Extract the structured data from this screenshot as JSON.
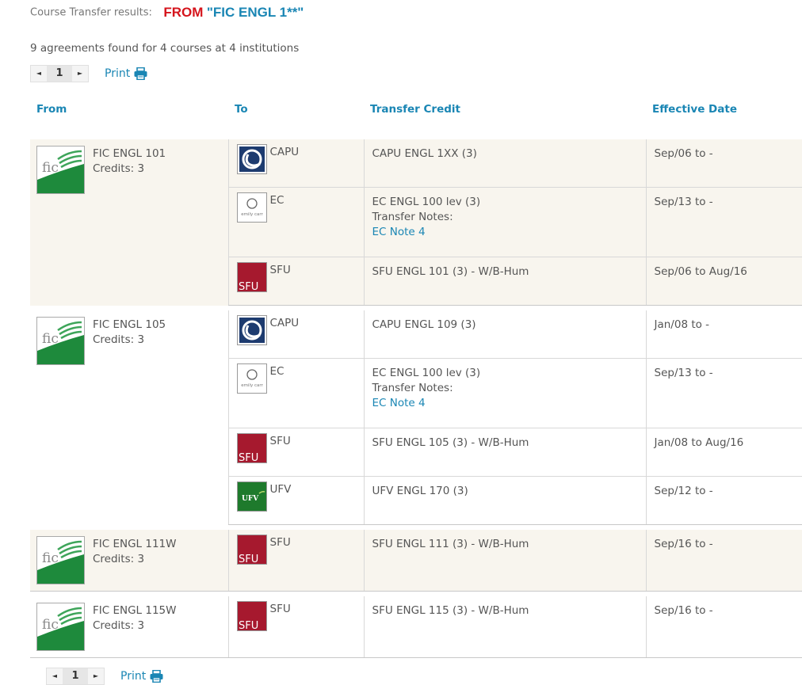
{
  "header": {
    "label": "Course Transfer results:",
    "from_label": "FROM",
    "query": "\"FIC ENGL 1**\""
  },
  "summary": "9 agreements found for 4 courses at 4 institutions",
  "pager": {
    "page": "1",
    "prev": "◄",
    "next": "►",
    "print_label": "Print"
  },
  "columns": [
    "From",
    "To",
    "Transfer Credit",
    "Effective Date"
  ],
  "logos": {
    "sfu_text": "SFU",
    "ufv_text": "UFV",
    "ec_text": "emily carr",
    "fic_text": "fic"
  },
  "colors": {
    "accent": "#1a86b4",
    "red": "#d5141c",
    "sfu_red": "#a6192e",
    "fic_green": "#1e8a3c",
    "ufv_green": "#1e7a2c",
    "capu_blue": "#1d3b6f",
    "row_shade": "#f8f5ee"
  },
  "groups": [
    {
      "course": "FIC ENGL 101",
      "credits": "Credits: 3",
      "rows": [
        {
          "inst": "CAPU",
          "logo": "capu",
          "credit": "CAPU ENGL 1XX (3)",
          "notes_label": "",
          "note": "",
          "date": "Sep/06 to -"
        },
        {
          "inst": "EC",
          "logo": "ec",
          "credit": "EC ENGL 100 lev (3)",
          "notes_label": "Transfer Notes:",
          "note": "EC Note 4",
          "date": "Sep/13 to -"
        },
        {
          "inst": "SFU",
          "logo": "sfu",
          "credit": "SFU ENGL 101 (3) - W/B-Hum",
          "notes_label": "",
          "note": "",
          "date": "Sep/06 to Aug/16"
        }
      ]
    },
    {
      "course": "FIC ENGL 105",
      "credits": "Credits: 3",
      "rows": [
        {
          "inst": "CAPU",
          "logo": "capu",
          "credit": "CAPU ENGL 109 (3)",
          "notes_label": "",
          "note": "",
          "date": "Jan/08 to -"
        },
        {
          "inst": "EC",
          "logo": "ec",
          "credit": "EC ENGL 100 lev (3)",
          "notes_label": "Transfer Notes:",
          "note": "EC Note 4",
          "date": "Sep/13 to -"
        },
        {
          "inst": "SFU",
          "logo": "sfu",
          "credit": "SFU ENGL 105 (3) - W/B-Hum",
          "notes_label": "",
          "note": "",
          "date": "Jan/08 to Aug/16"
        },
        {
          "inst": "UFV",
          "logo": "ufv",
          "credit": "UFV ENGL 170 (3)",
          "notes_label": "",
          "note": "",
          "date": "Sep/12 to -"
        }
      ]
    },
    {
      "course": "FIC ENGL 111W",
      "credits": "Credits: 3",
      "rows": [
        {
          "inst": "SFU",
          "logo": "sfu",
          "credit": "SFU ENGL 111 (3) - W/B-Hum",
          "notes_label": "",
          "note": "",
          "date": "Sep/16 to -"
        }
      ]
    },
    {
      "course": "FIC ENGL 115W",
      "credits": "Credits: 3",
      "rows": [
        {
          "inst": "SFU",
          "logo": "sfu",
          "credit": "SFU ENGL 115 (3) - W/B-Hum",
          "notes_label": "",
          "note": "",
          "date": "Sep/16 to -"
        }
      ]
    }
  ]
}
